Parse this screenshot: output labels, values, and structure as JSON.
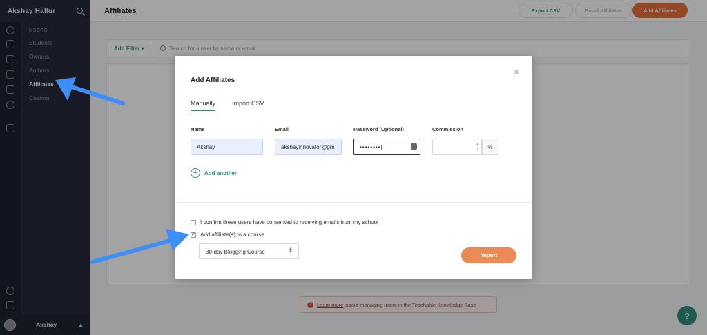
{
  "sidebar": {
    "user_name": "Akshay Hallur",
    "section_label": "USERS",
    "items": [
      {
        "label": "Students"
      },
      {
        "label": "Owners"
      },
      {
        "label": "Authors"
      },
      {
        "label": "Affiliates"
      },
      {
        "label": "Custom"
      }
    ],
    "footer_name": "Akshay"
  },
  "topbar": {
    "title": "Affiliates",
    "export_label": "Export CSV",
    "email_label": "Email Affiliates",
    "add_label": "Add Affiliates"
  },
  "filter": {
    "button_label": "Add Filter",
    "search_placeholder": "Search for a user by name or email"
  },
  "kb_banner": {
    "link_text": "Learn more",
    "text": "about managing users in the Teachable Knowledge Base"
  },
  "help_label": "?",
  "modal": {
    "title": "Add Affiliates",
    "close_glyph": "×",
    "tabs": [
      {
        "label": "Manually"
      },
      {
        "label": "Import CSV"
      }
    ],
    "columns": {
      "name": "Name",
      "email": "Email",
      "password": "Password (Optional)",
      "commission": "Commission"
    },
    "fields": {
      "name": "Akshay",
      "email": "akshayinnovator@gm",
      "password": "••••••••|",
      "commission": "",
      "percent": "%"
    },
    "add_another_label": "Add another",
    "consent_label": "I confirm these users have consented to receiving emails from my school",
    "course_check_label": "Add affiliate(s) to a course",
    "course_select_value": "30-day Blogging Course",
    "import_label": "Import"
  },
  "colors": {
    "accent_green": "#2f8f7b",
    "accent_orange": "#e9713a",
    "arrow_blue": "#3d8ef7"
  }
}
